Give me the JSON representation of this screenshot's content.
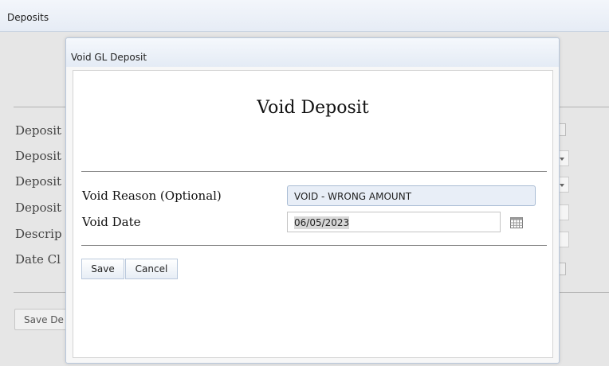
{
  "window": {
    "title": "Deposits"
  },
  "background": {
    "labels": [
      "Deposit",
      "Deposit",
      "Deposit",
      "Deposit",
      "Descrip",
      "Date Cl"
    ],
    "save_button": "Save De"
  },
  "dialog": {
    "title": "Void GL Deposit",
    "heading": "Void Deposit",
    "void_reason": {
      "label": "Void Reason (Optional)",
      "value": "VOID - WRONG AMOUNT"
    },
    "void_date": {
      "label": "Void Date",
      "value": "06/05/2023",
      "icon": "calendar-icon"
    },
    "buttons": {
      "save": "Save",
      "cancel": "Cancel"
    }
  }
}
